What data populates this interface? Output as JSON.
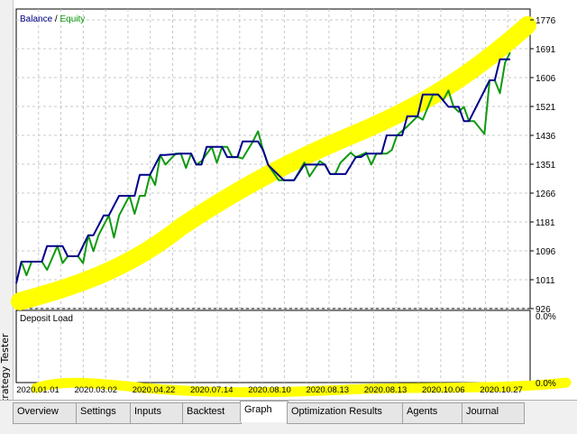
{
  "side_panel": {
    "label": "Strategy Tester"
  },
  "main_chart": {
    "legend": {
      "balance": "Balance",
      "separator": " / ",
      "equity": "Equity"
    },
    "colors": {
      "balance": "#00008b",
      "equity": "#109a10",
      "highlight": "#ffff00",
      "grid": "#c8c8c8"
    }
  },
  "sub_chart": {
    "title": "Deposit Load",
    "y_ticks": [
      "0.0%",
      "0.0%"
    ]
  },
  "tabs": [
    {
      "label": "Overview"
    },
    {
      "label": "Settings"
    },
    {
      "label": "Inputs"
    },
    {
      "label": "Backtest"
    },
    {
      "label": "Graph"
    },
    {
      "label": "Optimization Results"
    },
    {
      "label": "Agents"
    },
    {
      "label": "Journal"
    }
  ],
  "chart_data": {
    "type": "line",
    "y_ticks": [
      1776,
      1691,
      1606,
      1521,
      1436,
      1351,
      1266,
      1181,
      1096,
      1011,
      926
    ],
    "ylim": [
      926,
      1800
    ],
    "x_labels": [
      "2020.01.01",
      "2020.03.02",
      "2020.04.22",
      "2020.07.14",
      "2020.08.10",
      "2020.08.13",
      "2020.08.13",
      "2020.10.06",
      "2020.10.27"
    ],
    "x_count": 100,
    "series": [
      {
        "name": "Balance",
        "x": [
          0,
          1,
          5,
          6,
          9,
          10,
          12,
          14,
          15,
          17,
          18,
          20,
          23,
          24,
          26,
          28,
          29,
          32,
          34,
          35,
          36,
          37,
          40,
          41,
          43,
          44,
          47,
          48,
          49,
          52,
          54,
          56,
          60,
          61,
          64,
          66,
          67,
          68,
          71,
          72,
          75,
          76,
          78,
          79,
          82,
          84,
          86,
          87,
          88,
          92,
          93,
          94,
          96
        ],
        "y": [
          1000,
          1064,
          1064,
          1110,
          1110,
          1080,
          1080,
          1142,
          1142,
          1200,
          1200,
          1258,
          1258,
          1320,
          1320,
          1378,
          1378,
          1382,
          1382,
          1350,
          1350,
          1402,
          1402,
          1372,
          1372,
          1418,
          1418,
          1392,
          1348,
          1304,
          1304,
          1350,
          1350,
          1322,
          1322,
          1372,
          1372,
          1382,
          1382,
          1436,
          1436,
          1492,
          1492,
          1556,
          1556,
          1520,
          1520,
          1478,
          1478,
          1598,
          1598,
          1660,
          1660
        ]
      },
      {
        "name": "Equity",
        "x": [
          1,
          2,
          3,
          5,
          6,
          8,
          9,
          10,
          11,
          12,
          13,
          14,
          15,
          16,
          18,
          19,
          20,
          22,
          23,
          24,
          25,
          26,
          27,
          28,
          29,
          31,
          32,
          33,
          34,
          35,
          36,
          38,
          39,
          40,
          41,
          42,
          43,
          44,
          46,
          47,
          48,
          49,
          51,
          52,
          54,
          56,
          57,
          59,
          60,
          61,
          62,
          63,
          65,
          66,
          67,
          68,
          69,
          70,
          72,
          73,
          74,
          76,
          78,
          79,
          81,
          82,
          83,
          84,
          85,
          86,
          87,
          88,
          89,
          91,
          92,
          93,
          94,
          95,
          96
        ],
        "y": [
          1064,
          1024,
          1064,
          1064,
          1040,
          1110,
          1060,
          1080,
          1080,
          1080,
          1060,
          1142,
          1095,
          1142,
          1200,
          1135,
          1200,
          1258,
          1205,
          1258,
          1258,
          1320,
          1290,
          1378,
          1350,
          1382,
          1382,
          1340,
          1382,
          1350,
          1360,
          1402,
          1355,
          1402,
          1402,
          1372,
          1372,
          1368,
          1418,
          1448,
          1392,
          1348,
          1304,
          1304,
          1304,
          1356,
          1315,
          1360,
          1350,
          1322,
          1322,
          1355,
          1385,
          1372,
          1378,
          1385,
          1350,
          1382,
          1382,
          1393,
          1436,
          1462,
          1492,
          1482,
          1556,
          1556,
          1540,
          1568,
          1520,
          1505,
          1520,
          1478,
          1478,
          1440,
          1598,
          1598,
          1560,
          1650,
          1680
        ]
      }
    ]
  }
}
